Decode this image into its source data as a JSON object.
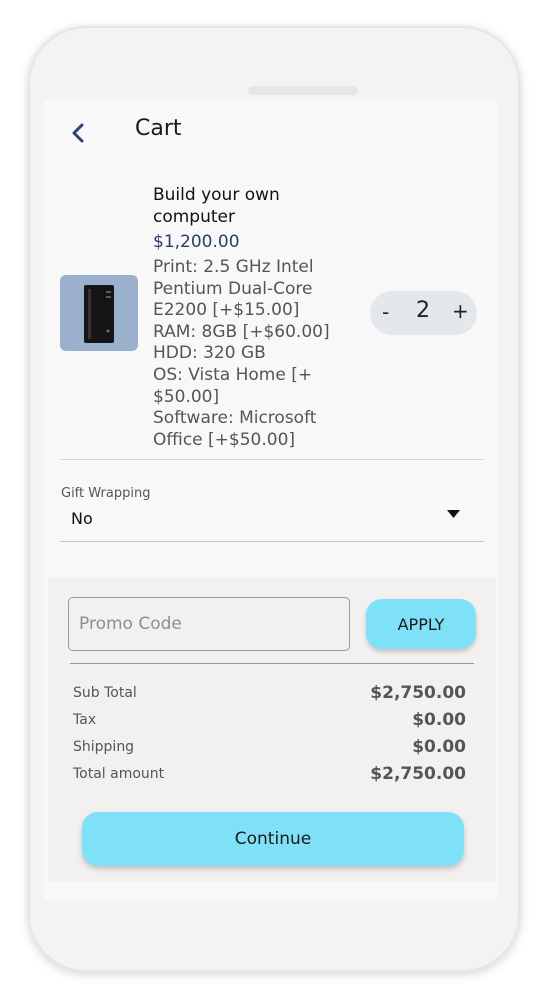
{
  "header": {
    "title": "Cart",
    "back_icon": "chevron-left-icon"
  },
  "product": {
    "name": "Build your own computer",
    "price": "$1,200.00",
    "attributes": [
      "Print: 2.5 GHz Intel",
      "Pentium Dual-Core",
      "E2200 [+$15.00]",
      "RAM: 8GB [+$60.00]",
      "HDD: 320 GB",
      "OS: Vista Home [+",
      "$50.00]",
      "Software: Microsoft",
      "Office [+$50.00]"
    ],
    "quantity": {
      "minus": "-",
      "value": "2",
      "plus": "+"
    }
  },
  "gift_wrapping": {
    "label": "Gift Wrapping",
    "value": "No"
  },
  "promo": {
    "placeholder": "Promo Code",
    "apply_label": "APPLY"
  },
  "totals": [
    {
      "label": "Sub Total",
      "value": "$2,750.00"
    },
    {
      "label": "Tax",
      "value": "$0.00"
    },
    {
      "label": "Shipping",
      "value": "$0.00"
    },
    {
      "label": "Total amount",
      "value": "$2,750.00"
    }
  ],
  "continue_label": "Continue",
  "colors": {
    "accent": "#7fe1f7",
    "price": "#2b3f66",
    "back": "#2d4373"
  }
}
